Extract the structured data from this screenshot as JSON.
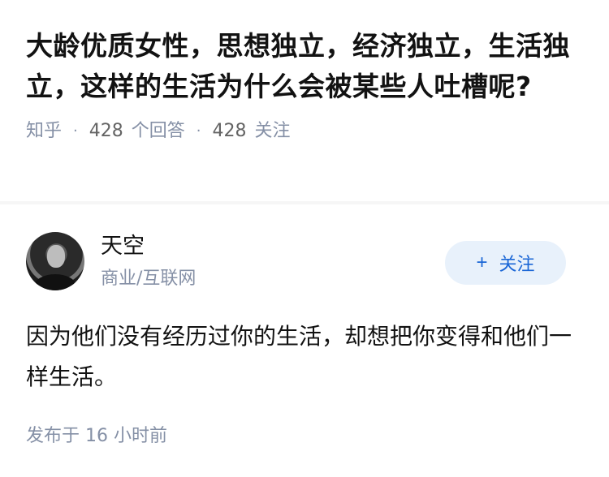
{
  "question": {
    "title": "大龄优质女性，思想独立，经济独立，生活独立，这样的生活为什么会被某些人吐槽呢?",
    "source": "知乎",
    "separator": "·",
    "answer_count": "428",
    "answer_label": "个回答",
    "follower_count": "428",
    "follower_label": "关注"
  },
  "answer": {
    "author": {
      "name": "天空",
      "headline": "商业/互联网",
      "avatar_icon": "user-avatar"
    },
    "follow_button": {
      "icon": "+",
      "label": "关注"
    },
    "content": "因为他们没有经历过你的生活，却想把你变得和他们一样生活。",
    "published": "发布于  16 小时前"
  },
  "colors": {
    "title": "#121212",
    "meta": "#8590a6",
    "follow_bg": "#e8f1fb",
    "follow_text": "#1a66d6"
  }
}
